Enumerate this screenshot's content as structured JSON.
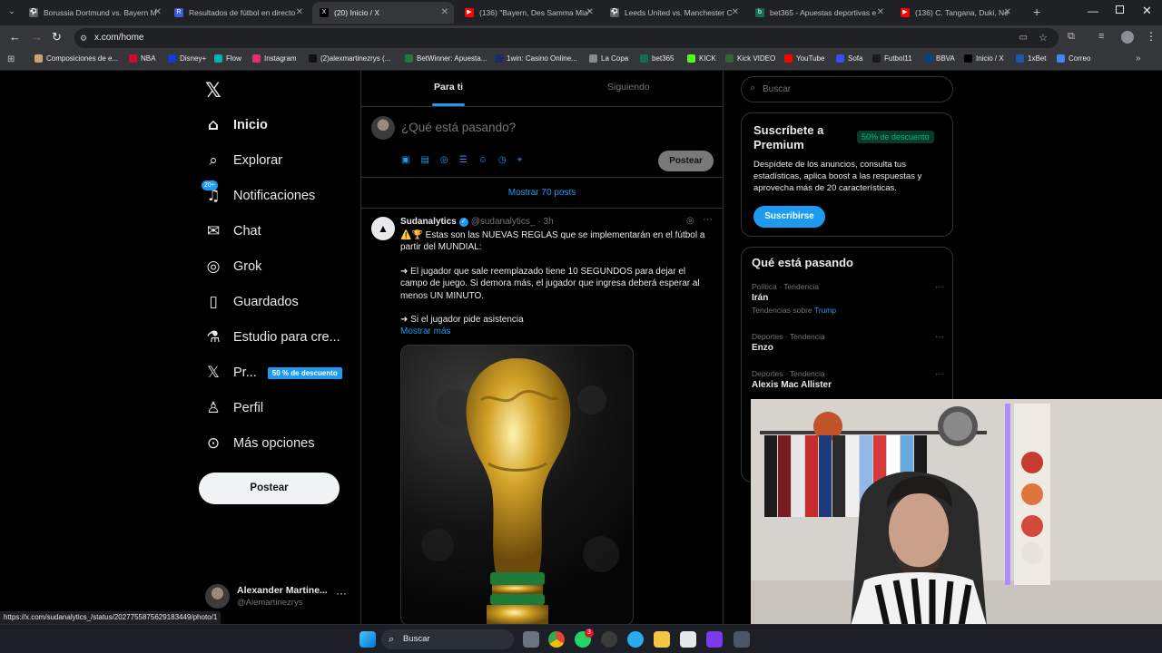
{
  "browser": {
    "tabs": [
      {
        "title": "Borussia Dortmund vs. Bayern M",
        "color": "#5f6368",
        "glyph": "⚽"
      },
      {
        "title": "Resultados de fútbol en directo",
        "color": "#3b5bdb",
        "glyph": "R"
      },
      {
        "title": "(20) Inicio / X",
        "color": "#000000",
        "glyph": "X"
      },
      {
        "title": "(136) \"Bayern, Des Samma Mia\"",
        "color": "#ff0000",
        "glyph": "▶"
      },
      {
        "title": "Leeds United vs. Manchester C",
        "color": "#5f6368",
        "glyph": "⚽"
      },
      {
        "title": "bet365 - Apuestas deportivas e",
        "color": "#126e51",
        "glyph": "b"
      },
      {
        "title": "(136) C. Tangana, Duki, Ne",
        "color": "#ff0000",
        "glyph": "▶"
      }
    ],
    "url": "x.com/home",
    "bookmarks": [
      {
        "label": "Composiciones de e...",
        "color": "#c5a572"
      },
      {
        "label": "NBA",
        "color": "#c8102e"
      },
      {
        "label": "Disney+",
        "color": "#113ccf"
      },
      {
        "label": "Flow",
        "color": "#00b2a9"
      },
      {
        "label": "Instagram",
        "color": "#e1306c"
      },
      {
        "label": "(2)alexmartinezrys (...",
        "color": "#111111"
      },
      {
        "label": "BetWinner: Apuesta...",
        "color": "#1f7a3c"
      },
      {
        "label": "1win: Casino Online...",
        "color": "#1d2a6b"
      },
      {
        "label": "La Copa",
        "color": "#8a8a8a"
      },
      {
        "label": "bet365",
        "color": "#126e51"
      },
      {
        "label": "KICK",
        "color": "#53fc18"
      },
      {
        "label": "Kick VIDEO",
        "color": "#2d6a2d"
      },
      {
        "label": "YouTube",
        "color": "#ff0000"
      },
      {
        "label": "Sofa",
        "color": "#374df5"
      },
      {
        "label": "Futbol11",
        "color": "#1a1a1a"
      },
      {
        "label": "BBVA",
        "color": "#004481"
      },
      {
        "label": "Inicio / X",
        "color": "#000000"
      },
      {
        "label": "1xBet",
        "color": "#1a5aa6"
      },
      {
        "label": "Correo",
        "color": "#4285f4"
      }
    ],
    "status_url": "https://x.com/sudanalytics_/status/2027755875629183449/photo/1"
  },
  "nav": {
    "items": [
      {
        "label": "Inicio",
        "icon": "home-icon"
      },
      {
        "label": "Explorar",
        "icon": "search-icon"
      },
      {
        "label": "Notificaciones",
        "icon": "bell-icon",
        "badge": "20+"
      },
      {
        "label": "Chat",
        "icon": "mail-icon"
      },
      {
        "label": "Grok",
        "icon": "grok-icon"
      },
      {
        "label": "Guardados",
        "icon": "bookmark-icon"
      },
      {
        "label": "Estudio para cre...",
        "icon": "flask-icon"
      },
      {
        "label": "Pr...",
        "icon": "x-premium-icon",
        "badge": "50 % de descuento"
      },
      {
        "label": "Perfil",
        "icon": "person-icon"
      },
      {
        "label": "Más opciones",
        "icon": "more-circle-icon"
      }
    ],
    "post_button": "Postear",
    "account": {
      "name": "Alexander Martine...",
      "handle": "@Alemartinezrys"
    }
  },
  "feed": {
    "tab_for_you": "Para ti",
    "tab_following": "Siguiendo",
    "composer_placeholder": "¿Qué está pasando?",
    "composer_post": "Postear",
    "show_more_posts": "Mostrar 70 posts",
    "post": {
      "author": "Sudanalytics",
      "handle": "@sudanalytics_",
      "time": "· 3h",
      "line1": "⚠️🏆 Estas son las NUEVAS REGLAS que se implementarán en el fútbol a partir del MUNDIAL:",
      "line2": "➜ El jugador que sale reemplazado tiene 10 SEGUNDOS para dejar el campo de juego. Si demora más, el jugador que ingresa deberá esperar al menos UN MINUTO.",
      "line3": "➜ Si el jugador pide asistencia",
      "show_more": "Mostrar más"
    }
  },
  "sidebar": {
    "search_placeholder": "Buscar",
    "premium": {
      "title": "Suscríbete a Premium",
      "badge": "50% de descuento",
      "text": "Despídete de los anuncios, consulta tus estadísticas, aplica boost a las respuestas y aprovecha más de 20 características.",
      "button": "Suscribirse"
    },
    "trends_title": "Qué está pasando",
    "trends": [
      {
        "meta": "Política · Tendencia",
        "name": "Irán",
        "extra_prefix": "Tendencias sobre",
        "extra_link": "Trump"
      },
      {
        "meta": "Deportes · Tendencia",
        "name": "Enzo"
      },
      {
        "meta": "Deportes · Tendencia",
        "name": "Alexis Mac Allister"
      }
    ]
  },
  "taskbar": {
    "search": "Buscar",
    "chat_badge": "3"
  },
  "colors": {
    "accent": "#1d9bf0",
    "green_badge": "#00ba7c",
    "background": "#000000",
    "border": "#2f3336"
  }
}
